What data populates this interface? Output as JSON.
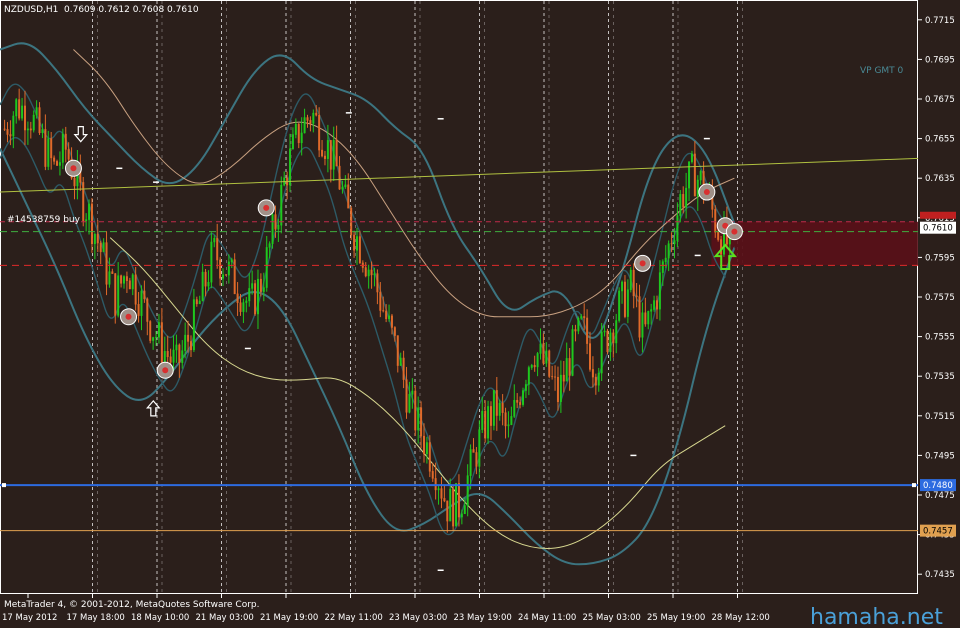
{
  "header": {
    "symbol": "NZDUSD,H1",
    "ohlc": "0.7609 0.7612 0.7608 0.7610"
  },
  "indicator_label": "VP GMT 0",
  "order_label": "#14538759 buy",
  "footer": {
    "copyright": "MetaTrader 4, © 2001-2012, MetaQuotes Software Corp.",
    "watermark": "hamaha.net"
  },
  "colors": {
    "background": "#2b1f1b",
    "bull": "#1ec81e",
    "bear": "#e06a2a",
    "band": "#3c7480",
    "ma_fast": "#c8a080",
    "ma_slow": "#d8d890",
    "support_blue": "#2d6be0",
    "support_orange": "#e0a050",
    "resistance": "#b0c040"
  },
  "chart_data": {
    "type": "line",
    "symbol": "NZDUSD",
    "timeframe": "H1",
    "ylim": [
      0.7425,
      0.7725
    ],
    "y_ticks": [
      0.7715,
      0.7695,
      0.7675,
      0.7655,
      0.7635,
      0.7615,
      0.7595,
      0.7575,
      0.7555,
      0.7535,
      0.7515,
      0.7495,
      0.7475,
      0.7455,
      0.7435
    ],
    "x_labels": [
      "17 May 2012",
      "17 May 18:00",
      "18 May 10:00",
      "21 May 03:00",
      "21 May 19:00",
      "22 May 11:00",
      "23 May 03:00",
      "23 May 19:00",
      "24 May 11:00",
      "25 May 03:00",
      "25 May 19:00",
      "28 May 12:00"
    ],
    "price_tags": [
      {
        "value": "0.7610",
        "kind": "current"
      },
      {
        "value": "0.7480",
        "kind": "blue-level"
      },
      {
        "value": "0.7457",
        "kind": "orange-level"
      }
    ],
    "levels": {
      "blue_support": 0.748,
      "orange_support": 0.7457,
      "order_entry": 0.7608,
      "stop": 0.7591,
      "upper_dashed": 0.7613
    },
    "price_path": [
      0.766,
      0.7672,
      0.7668,
      0.7655,
      0.764,
      0.765,
      0.763,
      0.7615,
      0.7595,
      0.7575,
      0.759,
      0.7575,
      0.756,
      0.7548,
      0.754,
      0.7555,
      0.7575,
      0.7598,
      0.759,
      0.758,
      0.757,
      0.7585,
      0.7612,
      0.764,
      0.766,
      0.7668,
      0.7655,
      0.764,
      0.7615,
      0.76,
      0.7585,
      0.7565,
      0.7545,
      0.752,
      0.7505,
      0.749,
      0.747,
      0.747,
      0.749,
      0.751,
      0.752,
      0.7505,
      0.753,
      0.755,
      0.754,
      0.7525,
      0.7545,
      0.756,
      0.754,
      0.7555,
      0.757,
      0.758,
      0.7555,
      0.7575,
      0.76,
      0.7625,
      0.7638,
      0.763,
      0.761,
      0.76
    ],
    "upper_band": [
      0.77,
      0.7705,
      0.769,
      0.767,
      0.7655,
      0.764,
      0.763,
      0.764,
      0.7665,
      0.769,
      0.77,
      0.7685,
      0.768,
      0.7675,
      0.766,
      0.765,
      0.761,
      0.759,
      0.7565,
      0.7575,
      0.758,
      0.7545,
      0.7585,
      0.764,
      0.766,
      0.765,
      0.7612
    ],
    "lower_band": [
      0.765,
      0.762,
      0.759,
      0.7555,
      0.753,
      0.752,
      0.7535,
      0.7555,
      0.757,
      0.758,
      0.757,
      0.754,
      0.751,
      0.7475,
      0.7455,
      0.746,
      0.747,
      0.7478,
      0.7465,
      0.745,
      0.744,
      0.744,
      0.7445,
      0.746,
      0.75,
      0.756,
      0.76
    ],
    "ma_fast": [
      0.77,
      0.7685,
      0.766,
      0.764,
      0.763,
      0.764,
      0.7655,
      0.7665,
      0.766,
      0.7645,
      0.762,
      0.7595,
      0.7575,
      0.7565,
      0.7565,
      0.7565,
      0.757,
      0.758,
      0.76,
      0.7615,
      0.7628,
      0.7635
    ],
    "ma_slow": [
      0.7605,
      0.759,
      0.757,
      0.755,
      0.7538,
      0.7533,
      0.7533,
      0.7535,
      0.7525,
      0.751,
      0.749,
      0.747,
      0.7455,
      0.7448,
      0.7448,
      0.7456,
      0.747,
      0.749,
      0.75,
      0.751
    ],
    "resistance_line": [
      0.7628,
      0.7645
    ],
    "markers": [
      {
        "x": 0.08,
        "y": 0.764
      },
      {
        "x": 0.14,
        "y": 0.7565
      },
      {
        "x": 0.18,
        "y": 0.7538
      },
      {
        "x": 0.29,
        "y": 0.762
      },
      {
        "x": 0.7,
        "y": 0.7592
      },
      {
        "x": 0.77,
        "y": 0.7628
      },
      {
        "x": 0.79,
        "y": 0.7611
      },
      {
        "x": 0.8,
        "y": 0.7608
      }
    ],
    "arrows": [
      {
        "x": 0.088,
        "y": 0.7658,
        "dir": "down"
      },
      {
        "x": 0.167,
        "y": 0.7518,
        "dir": "up"
      },
      {
        "x": 0.79,
        "y": 0.7594,
        "dir": "up",
        "big": true
      }
    ],
    "dash_marks": [
      {
        "x": 0.13,
        "y": 0.764
      },
      {
        "x": 0.17,
        "y": 0.7633
      },
      {
        "x": 0.27,
        "y": 0.7549
      },
      {
        "x": 0.38,
        "y": 0.7668
      },
      {
        "x": 0.48,
        "y": 0.7665
      },
      {
        "x": 0.48,
        "y": 0.7437
      },
      {
        "x": 0.69,
        "y": 0.7495
      },
      {
        "x": 0.77,
        "y": 0.7655
      },
      {
        "x": 0.76,
        "y": 0.7596
      }
    ]
  }
}
